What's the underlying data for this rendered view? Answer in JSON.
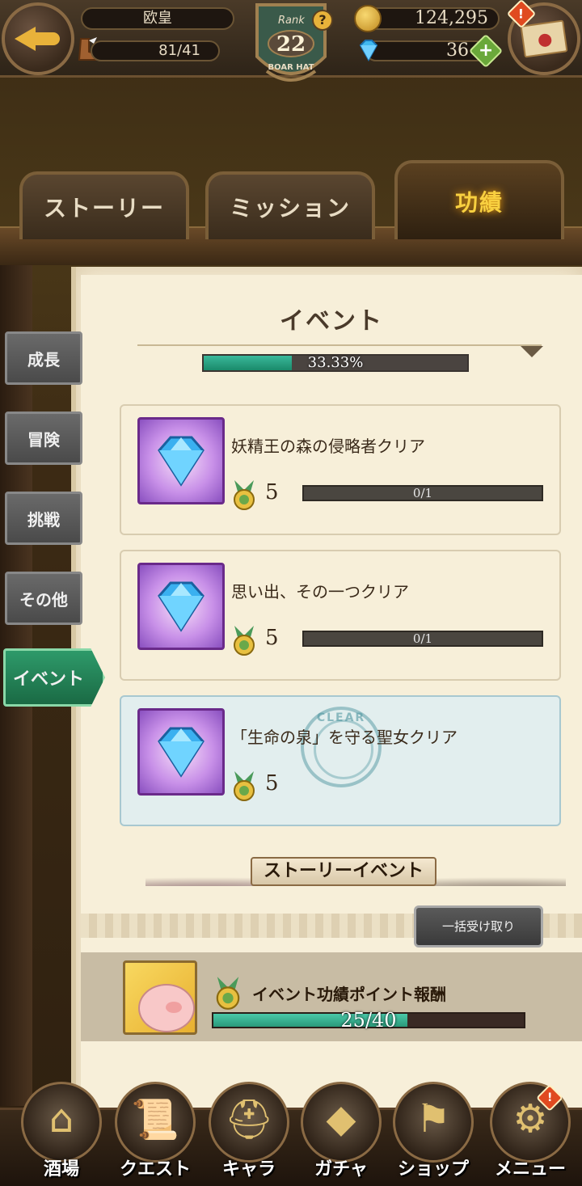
{
  "header": {
    "player_name": "欧皇",
    "stamina": "81/41",
    "rank_label": "Rank",
    "rank_value": "22",
    "rank_emblem_text": "BOAR HAT",
    "help_icon": "?",
    "gold": "124,295",
    "gems": "36",
    "alert_mark": "!"
  },
  "tabs": [
    {
      "label": "ストーリー",
      "active": false
    },
    {
      "label": "ミッション",
      "active": false
    },
    {
      "label": "功績",
      "active": true
    }
  ],
  "side_tabs": [
    {
      "label": "成長",
      "active": false
    },
    {
      "label": "冒険",
      "active": false
    },
    {
      "label": "挑戦",
      "active": false
    },
    {
      "label": "その他",
      "active": false
    },
    {
      "label": "イベント",
      "active": true
    }
  ],
  "section": {
    "title": "イベント",
    "progress_text": "33.33%",
    "progress_fraction": 0.3333
  },
  "achievements": [
    {
      "title": "妖精王の森の侵略者クリア",
      "points": "5",
      "progress": "0/1",
      "cleared": false,
      "icon": "blue-gem-icon"
    },
    {
      "title": "思い出、その一つクリア",
      "points": "5",
      "progress": "0/1",
      "cleared": false,
      "icon": "blue-gem-icon"
    },
    {
      "title": "「生命の泉」を守る聖女クリア",
      "points": "5",
      "progress": "",
      "cleared": true,
      "stamp_text": "CLEAR",
      "icon": "blue-gem-icon"
    }
  ],
  "banner": {
    "label": "ストーリーイベント"
  },
  "bulk_button": {
    "label": "一括受け取り"
  },
  "reward": {
    "title": "イベント功績ポイント報酬",
    "progress_text": "25/40",
    "progress_fraction": 0.625
  },
  "bottom_nav": [
    {
      "label": "酒場",
      "icon": "tavern-icon",
      "alert": false
    },
    {
      "label": "クエスト",
      "icon": "scroll-icon",
      "alert": false
    },
    {
      "label": "キャラ",
      "icon": "helmet-icon",
      "alert": false
    },
    {
      "label": "ガチャ",
      "icon": "crystal-icon",
      "alert": false
    },
    {
      "label": "ショップ",
      "icon": "shop-sign-icon",
      "alert": false
    },
    {
      "label": "メニュー",
      "icon": "gear-icon",
      "alert": true
    }
  ],
  "colors": {
    "accent_gold": "#f8d040",
    "progress_green": "#2aa888",
    "active_side_tab": "#2e9a6a"
  }
}
